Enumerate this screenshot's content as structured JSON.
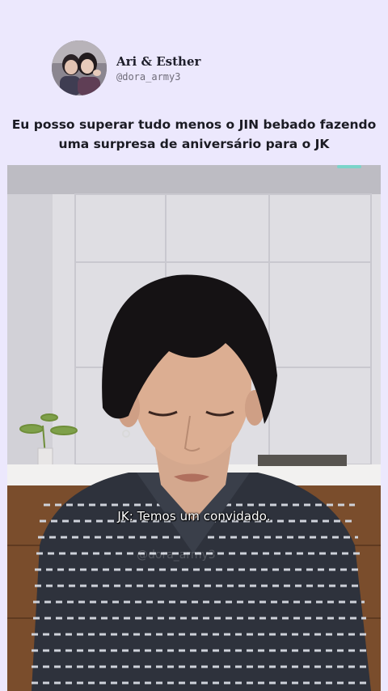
{
  "header": {
    "display_name": "Ari & Esther",
    "handle": "@dora_army3"
  },
  "post": {
    "caption": "Eu posso superar tudo menos o JIN bebado fazendo uma surpresa de aniversário para o JK"
  },
  "video": {
    "subtitle": "JK: Temos um convidado.",
    "watermark": "@dora_army3"
  },
  "colors": {
    "background": "#ece8fd",
    "caption_text": "#1b1b23",
    "video_wall": "#d8d7dd",
    "subtitle_text": "#ffffff"
  },
  "icons": {
    "avatar": "profile-photo"
  }
}
